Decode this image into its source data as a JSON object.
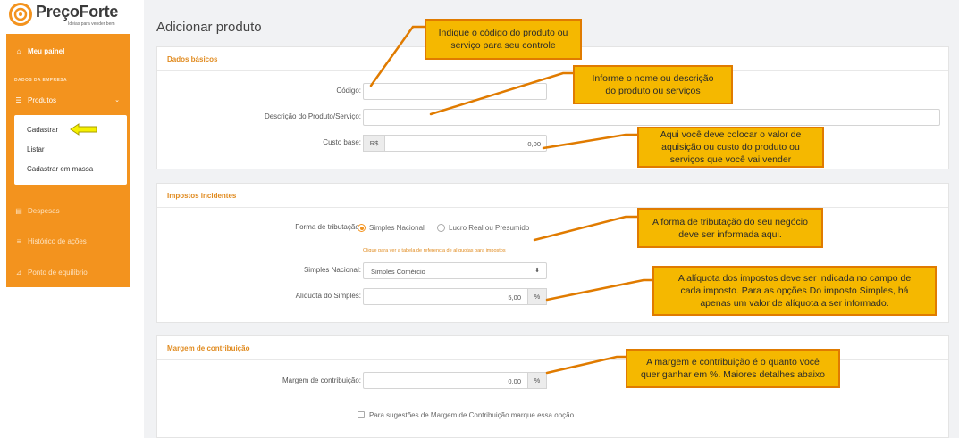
{
  "brand": {
    "name": "PreçoForte",
    "tagline": "Ideias para vender bem",
    "accent": "#f3931e",
    "callout_fill": "#f5b800",
    "callout_border": "#e07b00"
  },
  "sidebar": {
    "dashboard": "Meu painel",
    "section_label": "DADOS DA EMPRESA",
    "products": "Produtos",
    "submenu": [
      "Cadastrar",
      "Listar",
      "Cadastrar em massa"
    ],
    "items": [
      "Despesas",
      "Histórico de ações",
      "Ponto de equilíbrio"
    ]
  },
  "page": {
    "title": "Adicionar produto"
  },
  "basic": {
    "heading": "Dados básicos",
    "code_label": "Código:",
    "code_value": "",
    "description_label": "Descrição do Produto/Serviço:",
    "description_value": "",
    "cost_label": "Custo base:",
    "cost_prefix": "R$",
    "cost_value": "0,00"
  },
  "taxes": {
    "heading": "Impostos incidentes",
    "regime_label": "Forma de tributação:",
    "option_simples": "Simples Nacional",
    "option_lucro": "Lucro Real ou Presumido",
    "selected": "Simples Nacional",
    "table_link": "Clique para ver a tabela de referencia de alíquotas para impostos",
    "simples_label": "Simples Nacional:",
    "simples_value": "Simples Comércio",
    "rate_label": "Alíquota do Simples:",
    "rate_value": "5,00",
    "rate_suffix": "%"
  },
  "margin": {
    "heading": "Margem de contribuição",
    "label": "Margem de contribuição:",
    "value": "0,00",
    "suffix": "%",
    "checkbox_label": "Para sugestões de Margem de Contribuição marque essa opção.",
    "checked": false
  },
  "callouts": {
    "code": [
      "Indique o código do produto ou",
      "serviço para seu controle"
    ],
    "description": [
      "Informe o nome ou descrição",
      "do produto ou serviços"
    ],
    "cost": [
      "Aqui você deve colocar o valor de",
      "aquisição ou custo do produto ou",
      "serviços que você vai vender"
    ],
    "regime": [
      "A forma de tributação do seu negócio",
      "deve ser informada aqui."
    ],
    "rate": [
      "A alíquota dos impostos deve ser indicada no campo de",
      "cada imposto. Para as opções Do imposto Simples, há",
      "apenas um valor de alíquota a ser informado."
    ],
    "margin": [
      "A margem e contribuição é o quanto você",
      "quer ganhar em %. Maiores detalhes abaixo"
    ]
  }
}
